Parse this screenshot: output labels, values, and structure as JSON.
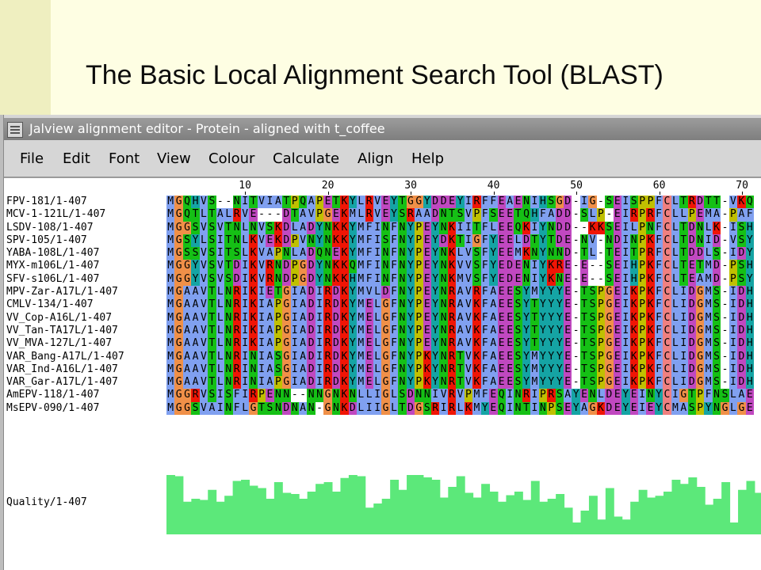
{
  "slide": {
    "title": "The Basic Local Alignment Search Tool (BLAST)"
  },
  "window": {
    "title": "Jalview alignment editor - Protein - aligned with t_coffee",
    "icon": "app-window-icon"
  },
  "menu": {
    "items": [
      "File",
      "Edit",
      "Font",
      "View",
      "Colour",
      "Calculate",
      "Align",
      "Help"
    ]
  },
  "ruler": {
    "ticks": [
      "10",
      "20",
      "30",
      "40",
      "50",
      "60",
      "70"
    ]
  },
  "alignment": {
    "sequences": [
      {
        "name": "FPV-181/1-407",
        "residues": "MGQHVS--NITVIATPQAPETKYLRVEYTGGYDDEYIRFFEAENIHSGD-IG-SEISPPFCLTRDTT-VKQ"
      },
      {
        "name": "MCV-1-121L/1-407",
        "residues": "MGQTLTALRVE---DTAVPGEKMLRVEYSRAADNTSVPFSEETQHFADD-SLP-EIRPRFCLLPEMA-PAF"
      },
      {
        "name": "LSDV-108/1-407",
        "residues": "MGGSVSVTNLNVSKDLADYNKKYMFINFNYPEYNKIITFLEEQKIYNDD--KKSEILPNFCLTDNLK-ISH"
      },
      {
        "name": "SPV-105/1-407",
        "residues": "MGSYLSITNLKVEKDPVNYNKKYMFISFNYPEYDKTIGFYEELDTYTDE-NV-NDINPKFCLTDNID-VSY"
      },
      {
        "name": "YABA-108L/1-407",
        "residues": "MGSSVSITSLKVAPNLADQNEKYMFINFNYPEYNKLVSFYEEMKNYNND-TL-TEITPRFCLTDDLS-IDY"
      },
      {
        "name": "MYX-m106L/1-407",
        "residues": "MGGYVSVTDIKVRNDPGDYNKKQMFINFNYPEYNKVVSFYEDENIYKRE-E--SEIHPKFCLTETMD-PSH"
      },
      {
        "name": "SFV-s106L/1-407",
        "residues": "MGGYVSVSDIKVRNDPGDYNKKHMFINFNYPEYNKMVSFYEDENIYKNE-E--SEIHPKFCLTEAMD-PSY"
      },
      {
        "name": "MPV-Zar-A17L/1-407",
        "residues": "MGAAVTLNRIKIETGIADIRDKYMVLDFNYPEYNRAVRFAEESYMYYYE-TSPGEIKPKFCLIDGMS-IDH"
      },
      {
        "name": "CMLV-134/1-407",
        "residues": "MGAAVTLNRIKIAPGIADIRDKYMELGFNYPEYNRAVKFAEESYTYYYE-TSPGEIKPKFCLIDGMS-IDH"
      },
      {
        "name": "VV_Cop-A16L/1-407",
        "residues": "MGAAVTLNRIKIAPGIADIRDKYMELGFNYPEYNRAVKFAEESYTYYYE-TSPGEIKPKFCLIDGMS-IDH"
      },
      {
        "name": "VV_Tan-TA17L/1-407",
        "residues": "MGAAVTLNRIKIAPGIADIRDKYMELGFNYPEYNRAVKFAEESYTYYYE-TSPGEIKPKFCLIDGMS-IDH"
      },
      {
        "name": "VV_MVA-127L/1-407",
        "residues": "MGAAVTLNRIKIAPGIADIRDKYMELGFNYPEYNRAVKFAEESYTYYYE-TSPGEIKPKFCLIDGMS-IDH"
      },
      {
        "name": "VAR_Bang-A17L/1-407",
        "residues": "MGAAVTLNRINIASGIADIRDKYMELGFNYPKYNRTVKFAEESYMYYYE-TSPGEIKPKFCLIDGMS-IDH"
      },
      {
        "name": "VAR_Ind-A16L/1-407",
        "residues": "MGAAVTLNRINIASGIADIRDKYMELGFNYPKYNRTVKFAEESYMYYYE-TSPGEIKPKFCLIDGMS-IDH"
      },
      {
        "name": "VAR_Gar-A17L/1-407",
        "residues": "MGAAVTLNRINIAPGIADIRDKYMELGFNYPKYNRTVKFAEESYMYYYE-TSPGEIKPKFCLIDGMS-IDH"
      },
      {
        "name": "AmEPV-118/1-407",
        "residues": "MGGRVSISFIRPENN--NNGNKNLLIGLSDNNIVRVPMFEQINRIPRSAYENLDEYEINYCIGTPFNSLAE"
      },
      {
        "name": "MsEPV-090/1-407",
        "residues": "MGGSVAINFLGTSNDNAN-GNKDLIIGLTDGSRIRLKMYEQINTINPSEYAGKDEYEIEYCMASPYNGLGE"
      }
    ]
  },
  "quality": {
    "label": "Quality/1-407",
    "color": "#5ce87a",
    "values": [
      1.0,
      0.98,
      0.55,
      0.6,
      0.58,
      0.75,
      0.55,
      0.65,
      0.9,
      0.92,
      0.82,
      0.78,
      0.6,
      0.88,
      0.7,
      0.68,
      0.6,
      0.72,
      0.85,
      0.88,
      0.72,
      0.95,
      1.0,
      0.98,
      0.45,
      0.52,
      0.6,
      0.92,
      0.75,
      1.0,
      1.0,
      0.96,
      0.92,
      0.62,
      0.8,
      0.98,
      0.7,
      0.62,
      0.85,
      0.72,
      0.55,
      0.66,
      0.72,
      0.58,
      0.9,
      0.55,
      0.6,
      0.68,
      0.45,
      0.2,
      0.4,
      0.65,
      0.25,
      0.78,
      0.3,
      0.25,
      0.55,
      0.75,
      0.62,
      0.65,
      0.72,
      0.92,
      0.85,
      0.96,
      0.8,
      0.5,
      0.6,
      0.88,
      0.2,
      0.75,
      0.9,
      0.7
    ]
  },
  "colors": {
    "slide_band": "#fefee3",
    "slide_strip": "#efefc0",
    "titlebar": "#8a8a8a",
    "window_bg": "#d6d6d6",
    "hydrophobic": "#80a0f0",
    "positive": "#f01505",
    "negative": "#c048c0",
    "polar": "#15c015",
    "cysteine": "#f08080",
    "glycine": "#f09048",
    "proline": "#c0c000",
    "aromatic": "#15a4a4"
  }
}
